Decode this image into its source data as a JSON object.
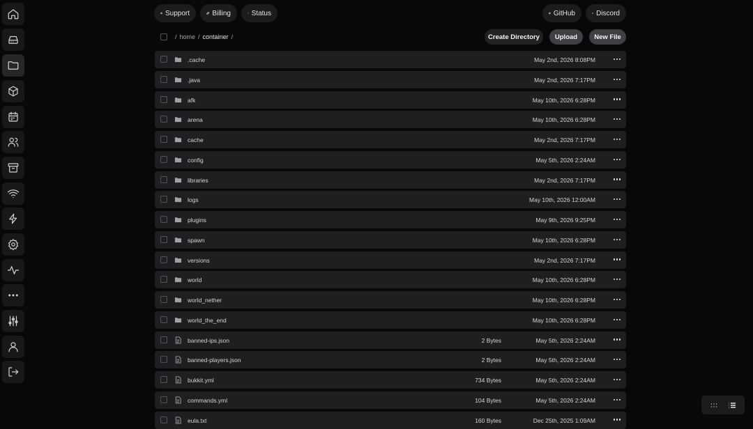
{
  "sidebar": {
    "items": [
      {
        "name": "home",
        "icon": "home-icon"
      },
      {
        "name": "console",
        "icon": "hard-drive-icon"
      },
      {
        "name": "files",
        "icon": "folder-icon",
        "active": true
      },
      {
        "name": "databases",
        "icon": "cube-icon"
      },
      {
        "name": "schedules",
        "icon": "calendar-icon"
      },
      {
        "name": "users",
        "icon": "users-icon"
      },
      {
        "name": "backups",
        "icon": "archive-icon"
      },
      {
        "name": "network",
        "icon": "wifi-icon"
      },
      {
        "name": "startup",
        "icon": "bolt-icon"
      },
      {
        "name": "settings",
        "icon": "gear-icon"
      },
      {
        "name": "activity",
        "icon": "activity-icon"
      },
      {
        "name": "more",
        "icon": "ellipsis-icon"
      },
      {
        "name": "admin",
        "icon": "sliders-icon"
      },
      {
        "name": "account",
        "icon": "user-icon"
      },
      {
        "name": "logout",
        "icon": "logout-icon"
      }
    ]
  },
  "topbar": {
    "support": "Support",
    "billing": "Billing",
    "status": "Status",
    "github": "GitHub",
    "discord": "Discord"
  },
  "breadcrumb": {
    "sep": "/",
    "home": "home",
    "container": "container"
  },
  "actions": {
    "create_directory": "Create Directory",
    "upload": "Upload",
    "new_file": "New File"
  },
  "files": [
    {
      "type": "folder",
      "name": ".cache",
      "size": "",
      "date": "May 2nd, 2026 8:08PM"
    },
    {
      "type": "folder",
      "name": ".java",
      "size": "",
      "date": "May 2nd, 2026 7:17PM"
    },
    {
      "type": "folder",
      "name": "afk",
      "size": "",
      "date": "May 10th, 2026 6:28PM"
    },
    {
      "type": "folder",
      "name": "arena",
      "size": "",
      "date": "May 10th, 2026 6:28PM"
    },
    {
      "type": "folder",
      "name": "cache",
      "size": "",
      "date": "May 2nd, 2026 7:17PM"
    },
    {
      "type": "folder",
      "name": "config",
      "size": "",
      "date": "May 5th, 2026 2:24AM"
    },
    {
      "type": "folder",
      "name": "libraries",
      "size": "",
      "date": "May 2nd, 2026 7:17PM"
    },
    {
      "type": "folder",
      "name": "logs",
      "size": "",
      "date": "May 10th, 2026 12:00AM"
    },
    {
      "type": "folder",
      "name": "plugins",
      "size": "",
      "date": "May 9th, 2026 9:25PM"
    },
    {
      "type": "folder",
      "name": "spawn",
      "size": "",
      "date": "May 10th, 2026 6:28PM"
    },
    {
      "type": "folder",
      "name": "versions",
      "size": "",
      "date": "May 2nd, 2026 7:17PM"
    },
    {
      "type": "folder",
      "name": "world",
      "size": "",
      "date": "May 10th, 2026 6:28PM"
    },
    {
      "type": "folder",
      "name": "world_nether",
      "size": "",
      "date": "May 10th, 2026 6:28PM"
    },
    {
      "type": "folder",
      "name": "world_the_end",
      "size": "",
      "date": "May 10th, 2026 6:28PM"
    },
    {
      "type": "file",
      "name": "banned-ips.json",
      "size": "2 Bytes",
      "date": "May 5th, 2026 2:24AM"
    },
    {
      "type": "file",
      "name": "banned-players.json",
      "size": "2 Bytes",
      "date": "May 5th, 2026 2:24AM"
    },
    {
      "type": "file",
      "name": "bukkit.yml",
      "size": "734 Bytes",
      "date": "May 5th, 2026 2:24AM"
    },
    {
      "type": "file",
      "name": "commands.yml",
      "size": "104 Bytes",
      "date": "May 5th, 2026 2:24AM"
    },
    {
      "type": "file",
      "name": "eula.txt",
      "size": "160 Bytes",
      "date": "Dec 25th, 2025 1:09AM"
    }
  ],
  "colors": {
    "background": "#080809",
    "row": "#1f1f22",
    "button": "#27272a",
    "text": "#e4e4e7"
  }
}
